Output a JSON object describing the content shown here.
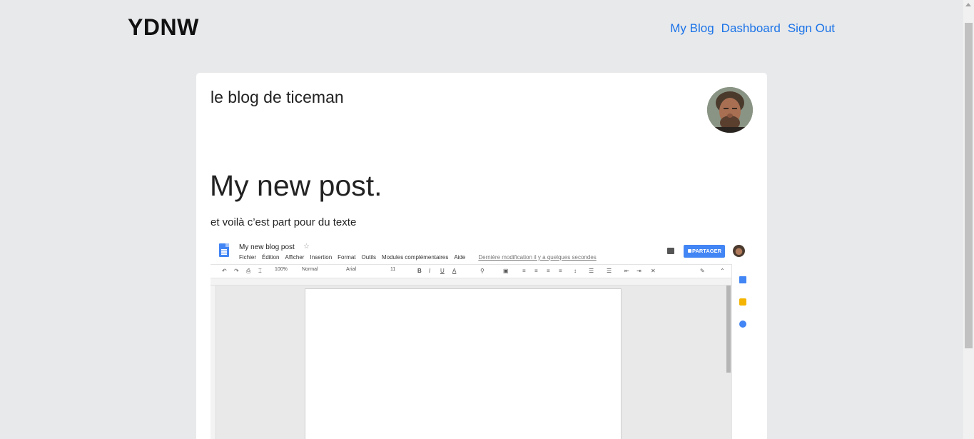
{
  "header": {
    "brand": "YDNW",
    "nav": [
      "My Blog",
      "Dashboard",
      "Sign Out"
    ]
  },
  "blog": {
    "title": "le blog de ticeman"
  },
  "post": {
    "title": "My new post.",
    "body": "et voilà c’est part pour du texte"
  },
  "embedded_screenshot": {
    "doc_name": "My new blog post",
    "menu": [
      "Fichier",
      "Édition",
      "Afficher",
      "Insertion",
      "Format",
      "Outils",
      "Modules complémentaires",
      "Aide"
    ],
    "last_modified": "Dernière modification il y a quelques secondes",
    "share_label": "PARTAGER",
    "zoom": "100%",
    "style": "Normal",
    "font": "Arial",
    "size": "11"
  },
  "colors": {
    "background": "#e8e9eb",
    "link": "#1a73e8",
    "docs_blue": "#4285f4"
  }
}
